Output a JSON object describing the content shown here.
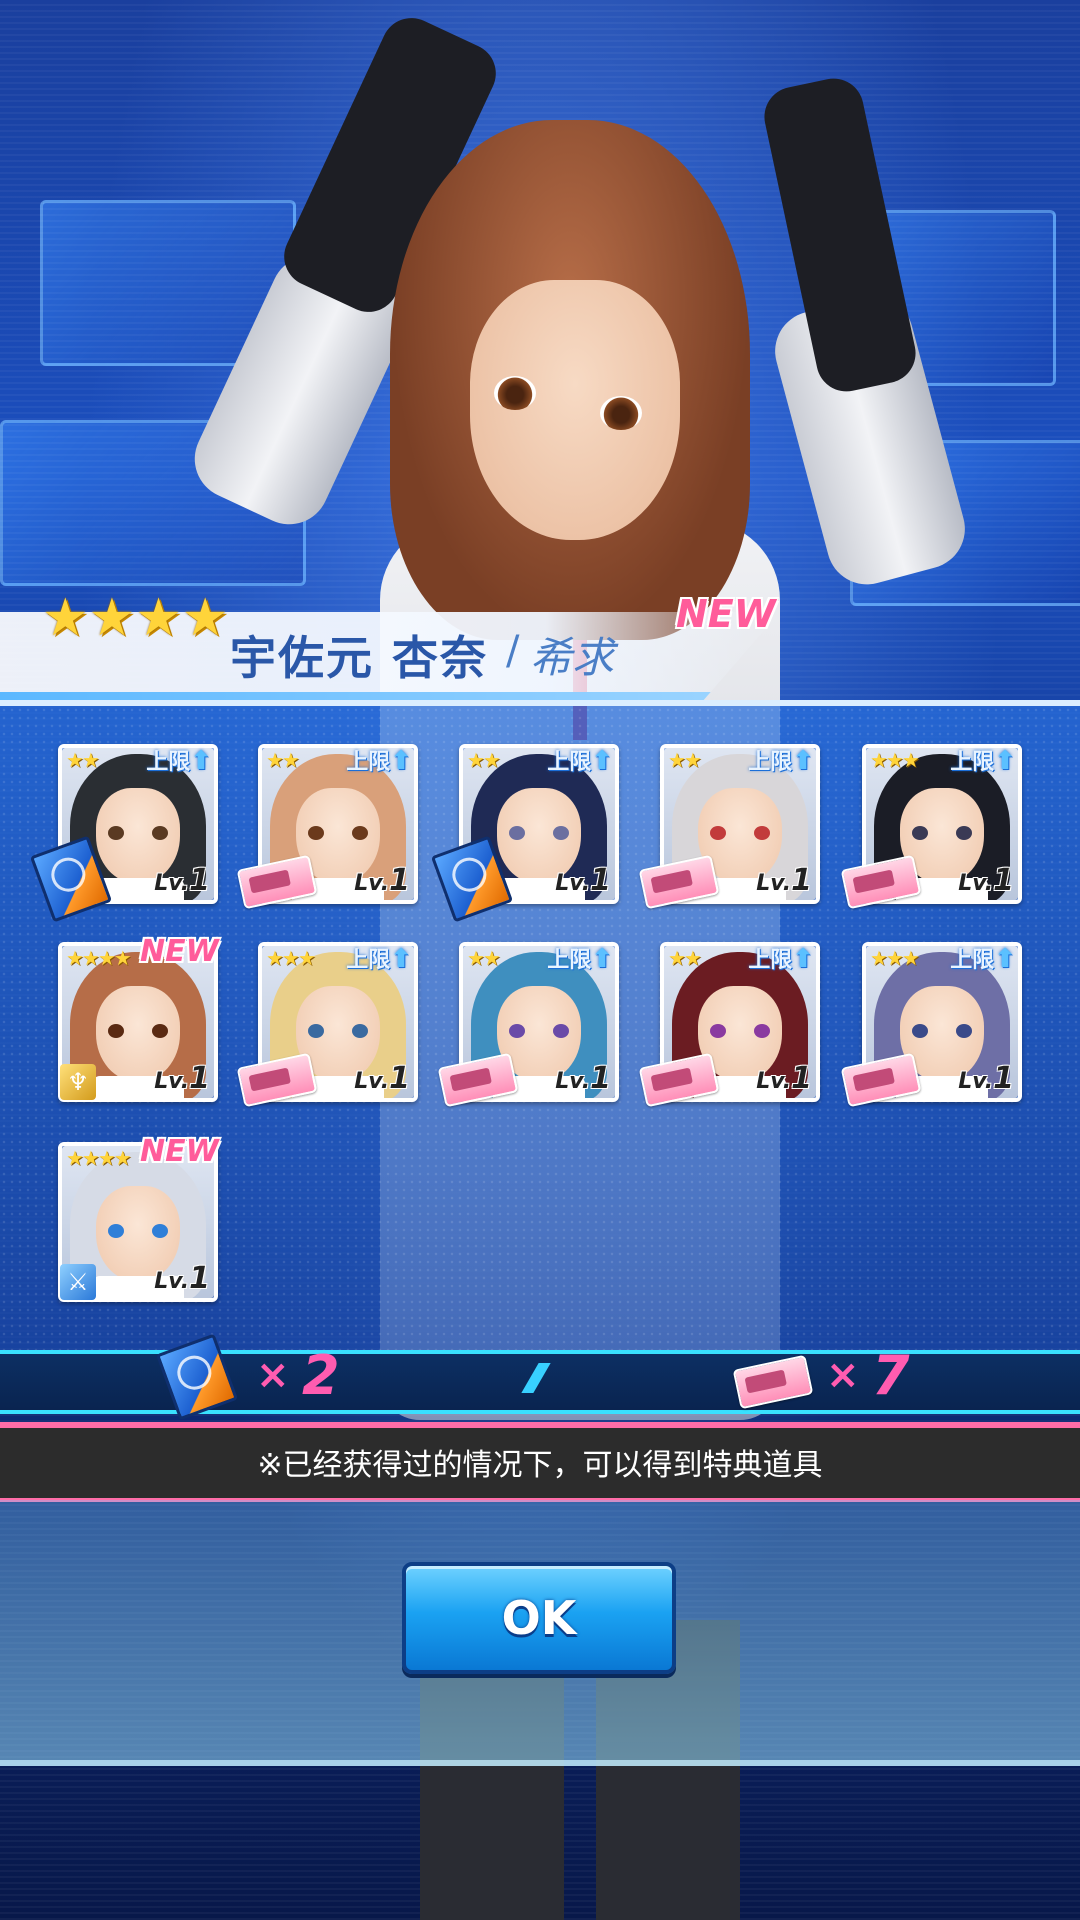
{
  "title": {
    "stars": "★★★★",
    "name": "宇佐元 杏奈",
    "separator": "/",
    "subtitle": "希求",
    "new_label": "NEW"
  },
  "cards": [
    {
      "stars": "★★",
      "badge": "上限",
      "level_prefix": "Lv.",
      "level": "1",
      "item": "book",
      "hair": "#2a2e33",
      "eye": "#5a3a22"
    },
    {
      "stars": "★★",
      "badge": "上限",
      "level_prefix": "Lv.",
      "level": "1",
      "item": "ticket",
      "hair": "#d9a07a",
      "eye": "#6b3a1c"
    },
    {
      "stars": "★★",
      "badge": "上限",
      "level_prefix": "Lv.",
      "level": "1",
      "item": "book",
      "hair": "#1f2a55",
      "eye": "#6b6fa0"
    },
    {
      "stars": "★★",
      "badge": "上限",
      "level_prefix": "Lv.",
      "level": "1",
      "item": "ticket",
      "hair": "#d8d6d9",
      "eye": "#c23b3b"
    },
    {
      "stars": "★★★",
      "badge": "上限",
      "level_prefix": "Lv.",
      "level": "1",
      "item": "ticket",
      "hair": "#1b1d26",
      "eye": "#3a3a55"
    },
    {
      "stars": "★★★★",
      "badge": "NEW",
      "level_prefix": "Lv.",
      "level": "1",
      "role": "gold",
      "hair": "#b66d48",
      "eye": "#5a2a12"
    },
    {
      "stars": "★★★",
      "badge": "上限",
      "level_prefix": "Lv.",
      "level": "1",
      "item": "ticket",
      "hair": "#e9cf8a",
      "eye": "#3a6aa0"
    },
    {
      "stars": "★★",
      "badge": "上限",
      "level_prefix": "Lv.",
      "level": "1",
      "item": "ticket",
      "hair": "#3f8fbf",
      "eye": "#6a4aa8"
    },
    {
      "stars": "★★",
      "badge": "上限",
      "level_prefix": "Lv.",
      "level": "1",
      "item": "ticket",
      "hair": "#6b1c22",
      "eye": "#8a3aa0"
    },
    {
      "stars": "★★★",
      "badge": "上限",
      "level_prefix": "Lv.",
      "level": "1",
      "item": "ticket",
      "hair": "#6e6fa6",
      "eye": "#3a4a8a"
    },
    {
      "stars": "★★★★",
      "badge": "NEW",
      "level_prefix": "Lv.",
      "level": "1",
      "role": "blue",
      "hair": "#d6dbe6",
      "eye": "#2f7fd8"
    }
  ],
  "summary": {
    "book_multiplier": "×",
    "book_count": "2",
    "ticket_multiplier": "×",
    "ticket_count": "7"
  },
  "notice": "※已经获得过的情况下，可以得到特典道具",
  "ok_button": "OK",
  "colors": {
    "accent_pink": "#ff5cb0",
    "accent_cyan": "#39e0ff",
    "button_blue": "#1aa2f2"
  }
}
